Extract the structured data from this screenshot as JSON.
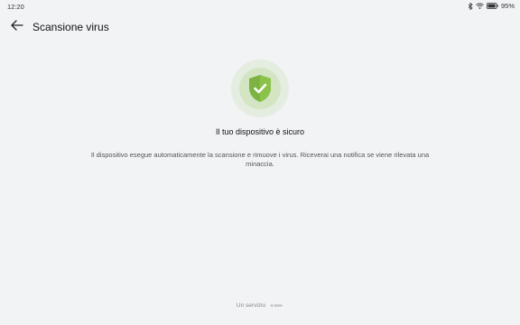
{
  "status_bar": {
    "time": "12:20",
    "battery_percent": "95%",
    "battery_level": 0.95,
    "icons": [
      "bluetooth-icon",
      "wifi-icon",
      "battery-icon"
    ]
  },
  "header": {
    "back_icon": "arrow-left-icon",
    "title": "Scansione virus"
  },
  "main": {
    "status_icon": "shield-check-icon",
    "heading": "Il tuo dispositivo è sicuro",
    "description": "Il dispositivo esegue automaticamente la scansione e rimuove i virus. Riceverai una notifica se viene rilevata una minaccia."
  },
  "footer": {
    "label": "Un servizio",
    "logo_icon": "provider-logo-icon"
  },
  "colors": {
    "background": "#f1f3f5",
    "accent_green": "#8bc34a",
    "shield_green": "#7cb342"
  }
}
